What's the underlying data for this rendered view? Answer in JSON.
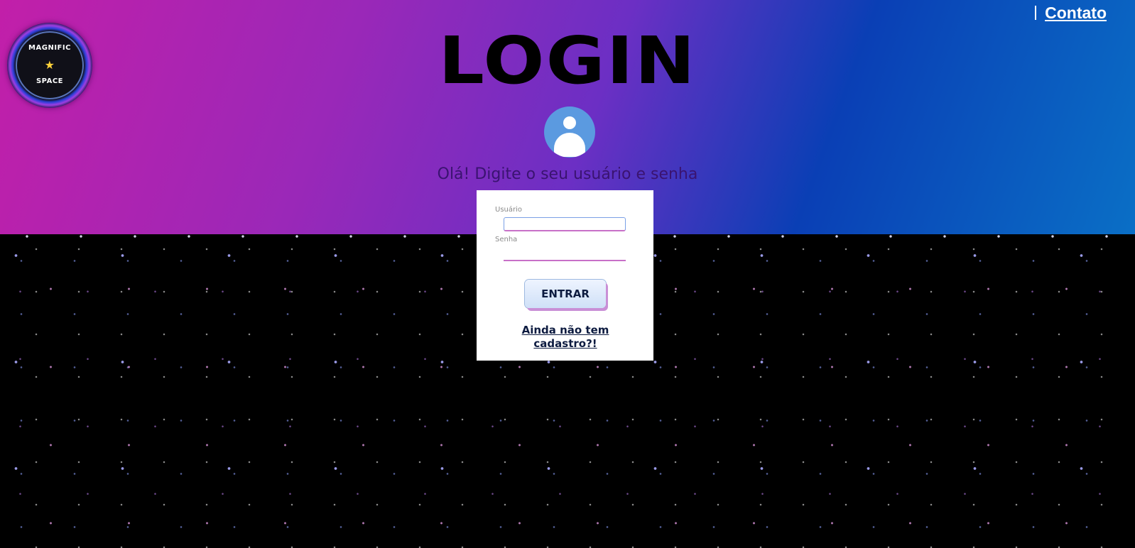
{
  "logo": {
    "line1": "MAGNIFIC",
    "star": "★",
    "line2": "SPACE"
  },
  "nav": {
    "separator": "|",
    "contact": "Contato"
  },
  "hero": {
    "title": "LOGIN",
    "greeting": "Olá! Digite o seu usuário e senha"
  },
  "form": {
    "user_label": "Usuário",
    "user_value": "",
    "password_label": "Senha",
    "password_value": "",
    "submit_label": "ENTRAR",
    "register_link": "Ainda não tem cadastro?!"
  },
  "icons": {
    "user": "user-avatar-icon"
  },
  "colors": {
    "gradient_left": "#c21fa9",
    "gradient_mid": "#6c2fc4",
    "gradient_right": "#0a6fc6",
    "background": "#000000",
    "card": "#ffffff",
    "input_accent": "#c870c8"
  }
}
